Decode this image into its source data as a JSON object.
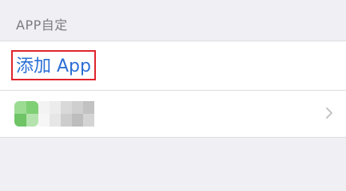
{
  "section": {
    "title": "APP自定"
  },
  "add_app": {
    "label": "添加 App"
  },
  "app_row": {
    "icon": "app-icon-pixelated",
    "name": "",
    "accessory": "chevron-right-icon"
  },
  "colors": {
    "background": "#efeff4",
    "cell": "#ffffff",
    "link": "#2b6fd6",
    "highlight_border": "#e0242d",
    "header_text": "#7c7c80",
    "chevron": "#c4c4c8"
  }
}
